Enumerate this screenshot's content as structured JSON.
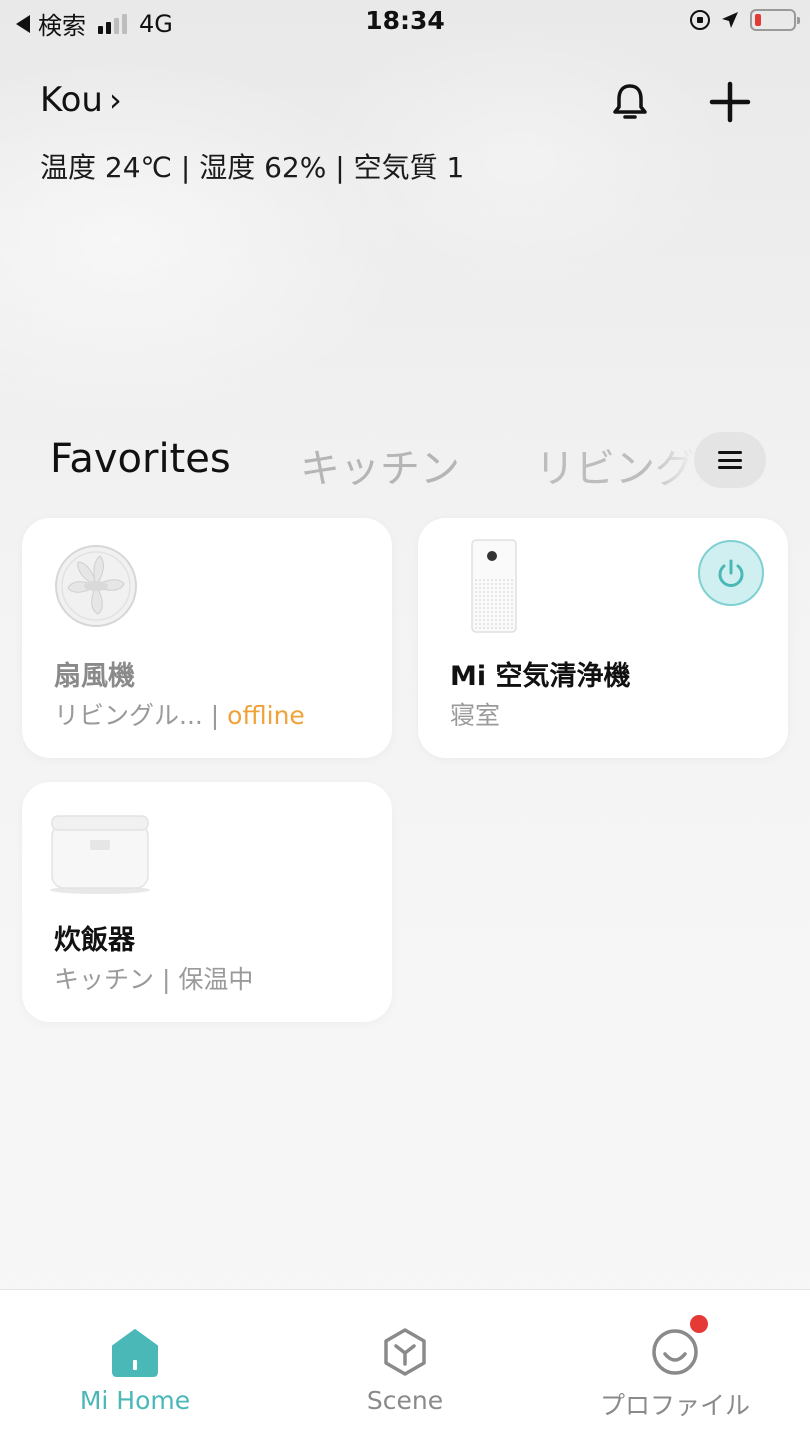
{
  "status_bar": {
    "back_label": "検索",
    "network": "4G",
    "time": "18:34"
  },
  "header": {
    "home_name": "Kou",
    "chevron": "›",
    "environment": "温度 24℃ | 湿度 62% | 空気質 1"
  },
  "tabs": [
    {
      "label": "Favorites",
      "active": true
    },
    {
      "label": "キッチン",
      "active": false
    },
    {
      "label": "リビング",
      "active": false
    }
  ],
  "devices": [
    {
      "name": "扇風機",
      "room": "リビングル... | ",
      "status": "offline",
      "icon": "fan-icon"
    },
    {
      "name": "Mi 空気清浄機",
      "room": "寝室",
      "status": "",
      "icon": "air-purifier-icon",
      "power": "on"
    },
    {
      "name": "炊飯器",
      "room": "キッチン | 保温中",
      "status": "",
      "icon": "rice-cooker-icon"
    }
  ],
  "bottom_nav": [
    {
      "label": "Mi Home",
      "icon": "home-icon",
      "active": true
    },
    {
      "label": "Scene",
      "icon": "scene-icon",
      "active": false
    },
    {
      "label": "プロファイル",
      "icon": "profile-icon",
      "active": false,
      "badge": true
    }
  ],
  "colors": {
    "accent": "#4bb8b8",
    "offline": "#f0a23a",
    "badge": "#e53935"
  }
}
